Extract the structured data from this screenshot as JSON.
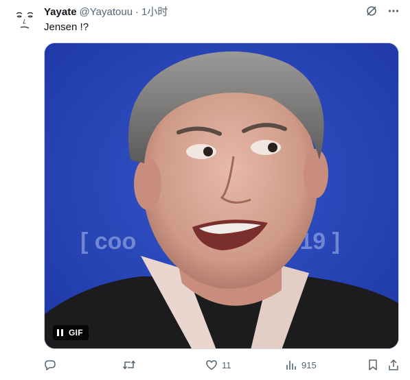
{
  "tweet": {
    "display_name": "Yayate",
    "handle": "@Yayatouu",
    "separator": "·",
    "time": "1小时",
    "text": "Jensen !?"
  },
  "media": {
    "badge_label": "GIF",
    "background_caption_left": "[ coo",
    "background_caption_right": "-19 ]"
  },
  "actions": {
    "reply": {
      "icon": "reply-icon",
      "count": ""
    },
    "retweet": {
      "icon": "retweet-icon",
      "count": ""
    },
    "like": {
      "icon": "heart-icon",
      "count": "11"
    },
    "views": {
      "icon": "views-icon",
      "count": "915"
    },
    "bookmark": {
      "icon": "bookmark-icon"
    },
    "share": {
      "icon": "share-icon"
    }
  },
  "colors": {
    "text_primary": "#0f1419",
    "text_secondary": "#536471",
    "media_background": "#2a46b8"
  }
}
